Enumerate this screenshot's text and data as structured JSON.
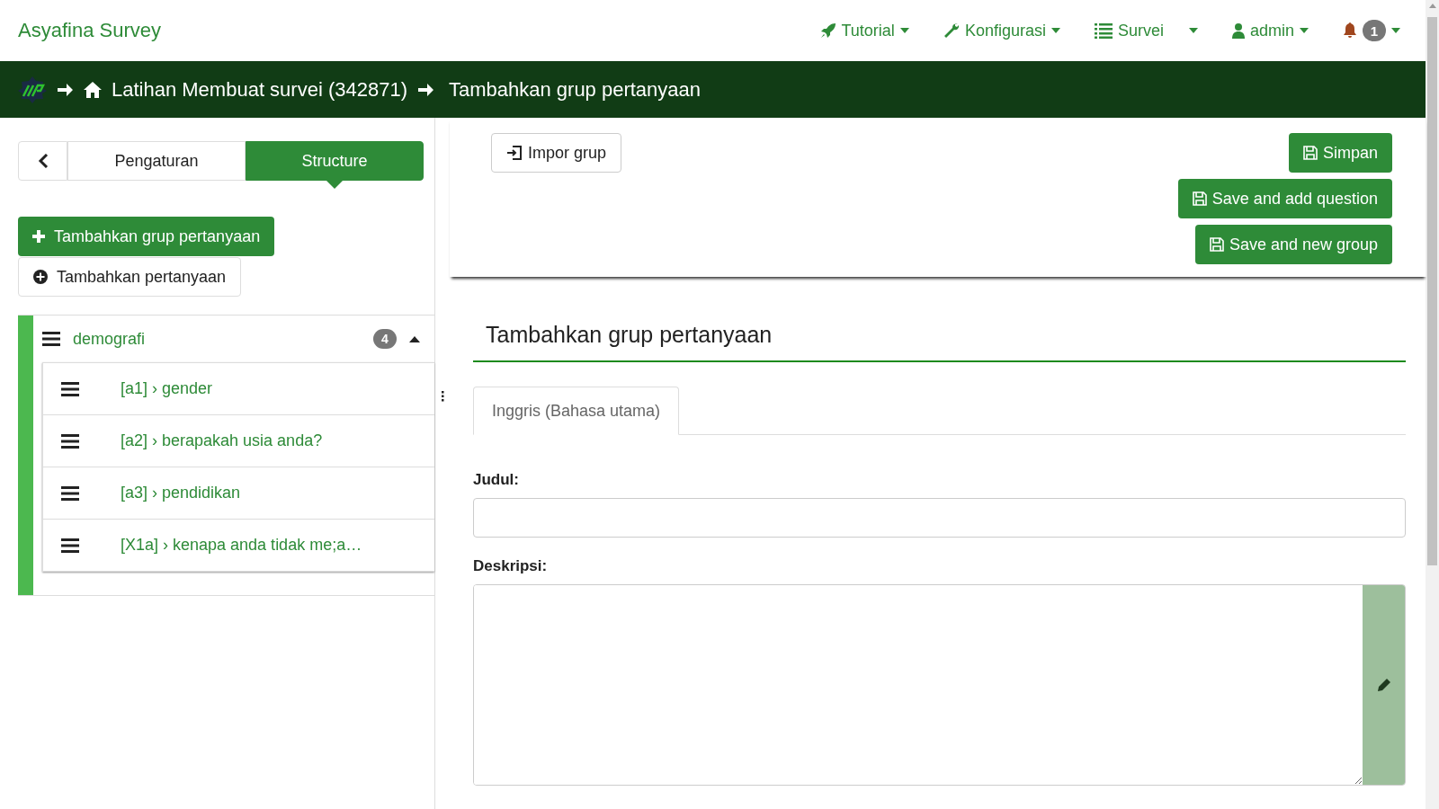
{
  "brand": "Asyafina Survey",
  "nav": [
    {
      "kind": "rocket",
      "label": "Tutorial"
    },
    {
      "kind": "wrench",
      "label": "Konfigurasi"
    },
    {
      "kind": "list",
      "label": "Survei"
    },
    {
      "kind": "user",
      "label": "admin"
    }
  ],
  "notifications": {
    "count": "1"
  },
  "breadcrumb": {
    "survey": "Latihan Membuat survei (342871)",
    "current": "Tambahkan grup pertanyaan"
  },
  "sidebar": {
    "tabs": [
      {
        "label": "Pengaturan",
        "selected": false
      },
      {
        "label": "Structure",
        "selected": true
      }
    ],
    "add_group_button": "Tambahkan grup pertanyaan",
    "add_question_button": "Tambahkan pertanyaan",
    "groups": [
      {
        "name": "demografi",
        "count": "4",
        "expanded": true,
        "questions": [
          "[a1] › gender",
          "[a2] › berapakah usia anda?",
          "[a3] › pendidikan",
          "[X1a] › kenapa anda tidak me;a…"
        ]
      }
    ]
  },
  "main": {
    "import_button": "Impor grup",
    "save_buttons": [
      "Simpan",
      "Save and add question",
      "Save and new group"
    ],
    "form": {
      "heading": "Tambahkan grup pertanyaan",
      "language_tabs": [
        {
          "label": "Inggris (Bahasa utama)",
          "selected": true
        }
      ],
      "fields": [
        {
          "kind": "text",
          "label": "Judul:"
        },
        {
          "kind": "textarea",
          "label": "Deskripsi:"
        }
      ]
    }
  }
}
